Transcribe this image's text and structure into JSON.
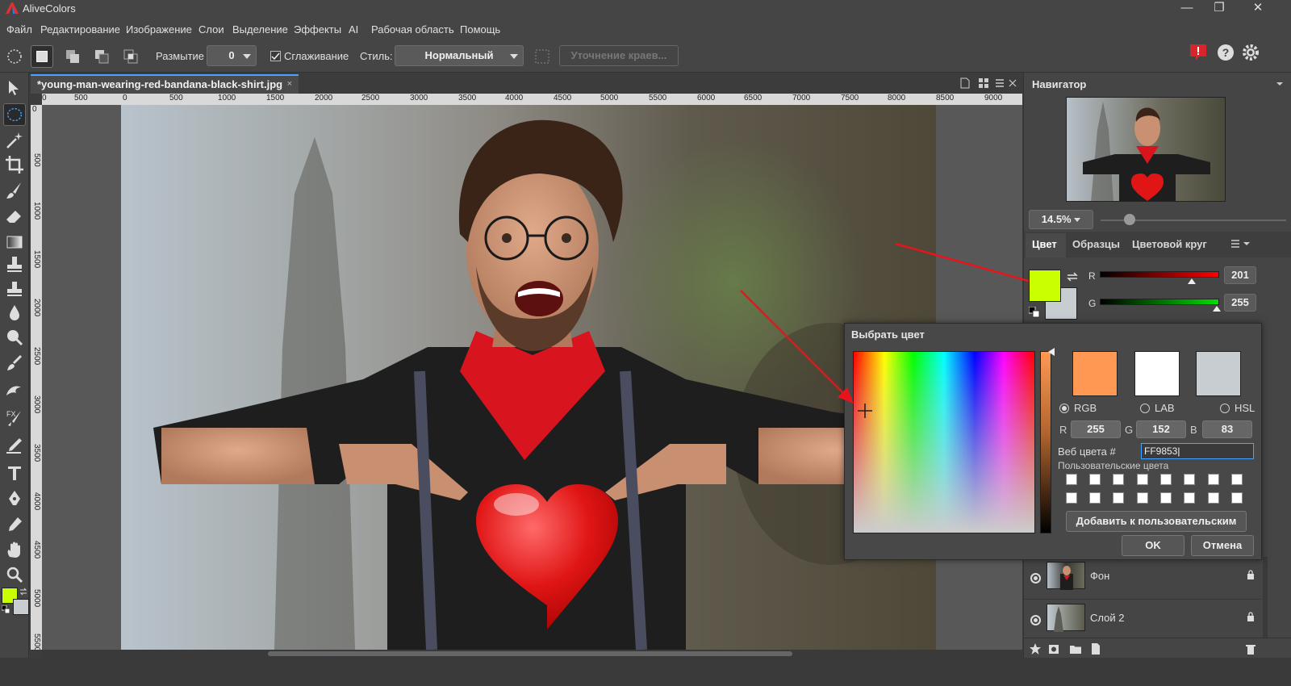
{
  "app": {
    "title": "AliveColors"
  },
  "window": {
    "minimize": "—",
    "restore": "❐",
    "close": "✕"
  },
  "menu": [
    "Файл",
    "Редактирование",
    "Изображение",
    "Слои",
    "Выделение",
    "Эффекты",
    "AI",
    "Рабочая область",
    "Помощь"
  ],
  "options": {
    "blur_label": "Размытие",
    "blur_value": "0",
    "smoothing_label": "Сглаживание",
    "style_label": "Стиль:",
    "style_value": "Нормальный",
    "refine_button": "Уточнение краев..."
  },
  "document": {
    "tab_name": "*young-man-wearing-red-bandana-black-shirt.jpg",
    "close": "×"
  },
  "rulers": {
    "h": [
      "0",
      "500",
      "0",
      "500",
      "1000",
      "1500",
      "2000",
      "2500",
      "3000",
      "3500",
      "4000",
      "4500",
      "5000",
      "5500",
      "6000",
      "6500",
      "7000",
      "7500",
      "8000",
      "8500",
      "9000"
    ],
    "v": [
      "0",
      "500",
      "1000",
      "1500",
      "2000",
      "2500",
      "3000",
      "3500",
      "4000",
      "4500",
      "5000",
      "5500"
    ]
  },
  "navigator": {
    "title": "Навигатор",
    "zoom": "14.5%",
    "zoom_fraction": 0.16
  },
  "color_panel": {
    "tabs": [
      "Цвет",
      "Образцы",
      "Цветовой круг"
    ],
    "foreground": "#c9ff00",
    "background": "#c8cdd2",
    "channels": [
      {
        "label": "R",
        "value": "201"
      },
      {
        "label": "G",
        "value": "255"
      }
    ]
  },
  "color_dialog": {
    "title": "Выбрать цвет",
    "swatch_new": "#ff9853",
    "swatch_white": "#ffffff",
    "swatch_old": "#c8cdd2",
    "modes": [
      "RGB",
      "LAB",
      "HSL"
    ],
    "selected_mode": "RGB",
    "r_label": "R",
    "r_value": "255",
    "g_label": "G",
    "g_value": "152",
    "b_label": "B",
    "b_value": "83",
    "hex_label": "Веб цвета #",
    "hex_value": "FF9853",
    "custom_label": "Пользовательские цвета",
    "add_custom": "Добавить к пользовательским",
    "ok": "OK",
    "cancel": "Отмена"
  },
  "layers": [
    {
      "name": "Фон"
    },
    {
      "name": "Слой 2"
    }
  ],
  "colors": {
    "accent": "#4aa3ff",
    "arrow": "#e8141b"
  }
}
